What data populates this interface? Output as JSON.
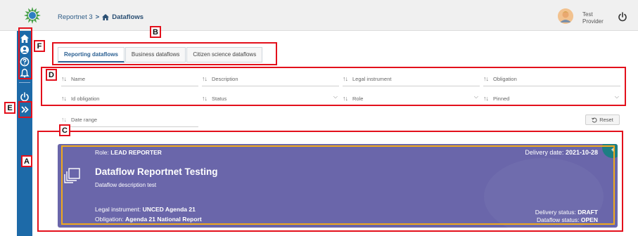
{
  "header": {
    "breadcrumb": [
      "Reportnet 3"
    ],
    "breadcrumb_separator": ">",
    "current_page": "Dataflows",
    "user": {
      "line1": "Test",
      "line2": "Provider"
    }
  },
  "sidebar": {
    "icons": [
      "home-icon",
      "user-icon",
      "help-icon",
      "notifications-icon",
      "logout-icon",
      "expand-icon"
    ]
  },
  "tabs": [
    {
      "label": "Reporting dataflows",
      "active": true
    },
    {
      "label": "Business dataflows",
      "active": false
    },
    {
      "label": "Citizen science dataflows",
      "active": false
    }
  ],
  "filters": {
    "name": "Name",
    "description": "Description",
    "legal_instrument": "Legal instrument",
    "obligation": "Obligation",
    "id_obligation": "Id obligation",
    "status": "Status",
    "role": "Role",
    "pinned": "Pinned",
    "date_range": "Date range",
    "reset_label": "Reset"
  },
  "card": {
    "role_label": "Role:",
    "role_value": "LEAD REPORTER",
    "delivery_date_label": "Delivery date:",
    "delivery_date_value": "2021-10-28",
    "title": "Dataflow Reportnet Testing",
    "description": "Dataflow description test",
    "legal_instrument_label": "Legal instrument:",
    "legal_instrument_value": "UNCED Agenda 21",
    "obligation_label": "Obligation:",
    "obligation_value": "Agenda 21 National Report",
    "delivery_status_label": "Delivery status:",
    "delivery_status_value": "DRAFT",
    "dataflow_status_label": "Dataflow status:",
    "dataflow_status_value": "OPEN",
    "color": "#6a66aa"
  },
  "annotations": {
    "a": "A",
    "b": "B",
    "c": "C",
    "d": "D",
    "e": "E",
    "f": "F"
  },
  "colors": {
    "sidebar": "#1d6aa8",
    "annotation": "#e3101c",
    "highlight": "#f0a91e",
    "accent": "#2a5f92"
  }
}
